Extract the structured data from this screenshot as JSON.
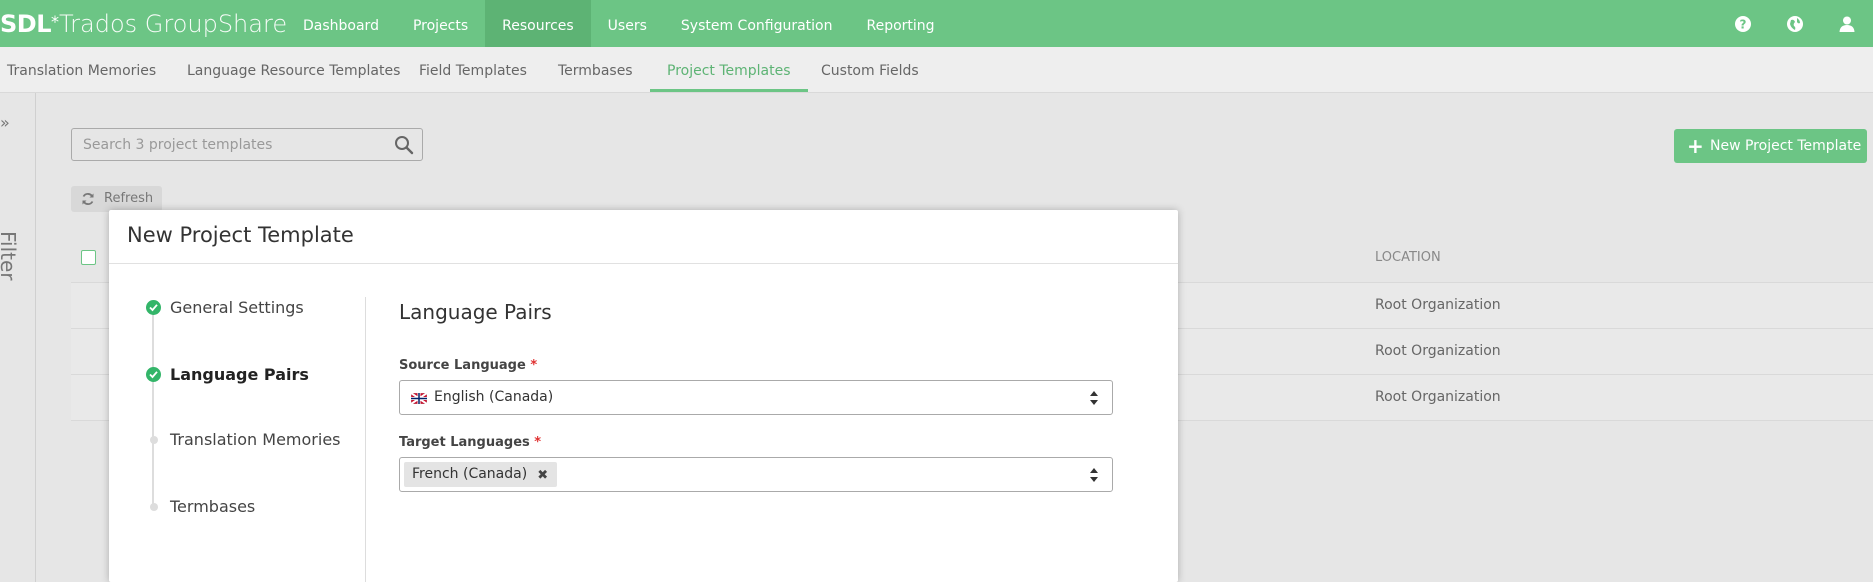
{
  "app": {
    "logo_brand": "SDL",
    "logo_star": "*",
    "logo_product": "Trados GroupShare"
  },
  "topnav": {
    "items": [
      {
        "label": "Dashboard"
      },
      {
        "label": "Projects"
      },
      {
        "label": "Resources",
        "active": true
      },
      {
        "label": "Users"
      },
      {
        "label": "System Configuration"
      },
      {
        "label": "Reporting"
      }
    ],
    "icons": [
      "help-icon",
      "globe-icon",
      "user-icon"
    ]
  },
  "subnav": {
    "items": [
      {
        "label": "Translation Memories"
      },
      {
        "label": "Language Resource Templates"
      },
      {
        "label": "Field Templates"
      },
      {
        "label": "Termbases"
      },
      {
        "label": "Project Templates",
        "active": true
      },
      {
        "label": "Custom Fields"
      }
    ]
  },
  "filter": {
    "label": "Filter",
    "toggle_glyph": "»"
  },
  "search": {
    "placeholder": "Search 3 project templates",
    "value": ""
  },
  "toolbar": {
    "refresh_label": "Refresh",
    "new_label": "New Project Template"
  },
  "table": {
    "location_header": "LOCATION",
    "rows": [
      {
        "location": "Root Organization"
      },
      {
        "location": "Root Organization"
      },
      {
        "location": "Root Organization"
      }
    ]
  },
  "modal": {
    "title": "New Project Template",
    "steps": [
      {
        "label": "General Settings",
        "status": "done"
      },
      {
        "label": "Language Pairs",
        "status": "current"
      },
      {
        "label": "Translation Memories",
        "status": "pending"
      },
      {
        "label": "Termbases",
        "status": "pending"
      }
    ],
    "section_title": "Language Pairs",
    "source_label": "Source Language",
    "required_mark": "*",
    "source_value": "English (Canada)",
    "target_label": "Target Languages",
    "target_tags": [
      {
        "label": "French (Canada)",
        "remove_glyph": "✖"
      }
    ]
  },
  "colors": {
    "brand_green": "#6cc585",
    "check_green": "#33b569",
    "required_red": "#e03131"
  }
}
